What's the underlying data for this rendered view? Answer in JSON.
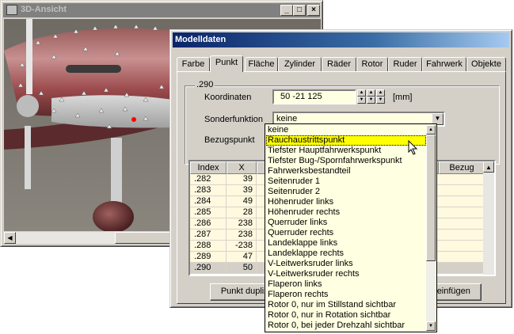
{
  "window3d": {
    "title": "3D-Ansicht",
    "buttons": [
      "_",
      "□",
      "×"
    ]
  },
  "dialog": {
    "title": "Modelldaten",
    "tabs": [
      {
        "label": "Farbe"
      },
      {
        "label": "Punkt"
      },
      {
        "label": "Fläche"
      },
      {
        "label": "Zylinder"
      },
      {
        "label": "Räder"
      },
      {
        "label": "Rotor"
      },
      {
        "label": "Ruder"
      },
      {
        "label": "Fahrwerk"
      },
      {
        "label": "Objekte"
      }
    ],
    "active_tab": "Punkt",
    "group_label": ".290",
    "koordinaten_label": "Koordinaten",
    "koordinaten_value": "50  -21  125",
    "unit": "[mm]",
    "sonderfunktion_label": "Sonderfunktion",
    "sonderfunktion_value": "keine",
    "bezugspunkt_label": "Bezugspunkt",
    "table": {
      "headers": [
        "Index",
        "X",
        "Bezug"
      ],
      "rows": [
        {
          "index": ".282",
          "x": "39"
        },
        {
          "index": ".283",
          "x": "39"
        },
        {
          "index": ".284",
          "x": "49"
        },
        {
          "index": ".285",
          "x": "28"
        },
        {
          "index": ".286",
          "x": "238"
        },
        {
          "index": ".287",
          "x": "238"
        },
        {
          "index": ".288",
          "x": "-238"
        },
        {
          "index": ".289",
          "x": "47"
        },
        {
          "index": ".290",
          "x": "50"
        }
      ],
      "selected_index": ".290"
    },
    "button_left": "Punkt duplizi",
    "button_right": "kt einfügen"
  },
  "dropdown": {
    "items": [
      "keine",
      "Rauchaustrittspunkt",
      "Tiefster Hauptfahrwerkspunkt",
      "Tiefster Bug-/Spornfahrwerkspunkt",
      "Fahrwerksbestandteil",
      "Seitenruder 1",
      "Seitenruder 2",
      "Höhenruder links",
      "Höhenruder rechts",
      "Querruder links",
      "Querruder rechts",
      "Landeklappe links",
      "Landeklappe rechts",
      "V-Leitwerksruder links",
      "V-Leitwerksruder rechts",
      "Flaperon links",
      "Flaperon rechts",
      "Rotor 0, nur im Stillstand sichtbar",
      "Rotor 0, nur in Rotation sichtbar",
      "Rotor 0, bei jeder Drehzahl sichtbar"
    ],
    "highlighted": "Rauchaustrittspunkt"
  },
  "colors": {
    "title_active": "#0a246a",
    "title_inactive": "#808080",
    "face": "#d4d0c8",
    "field_bg": "#ffffe1",
    "highlight": "#ffff00"
  }
}
